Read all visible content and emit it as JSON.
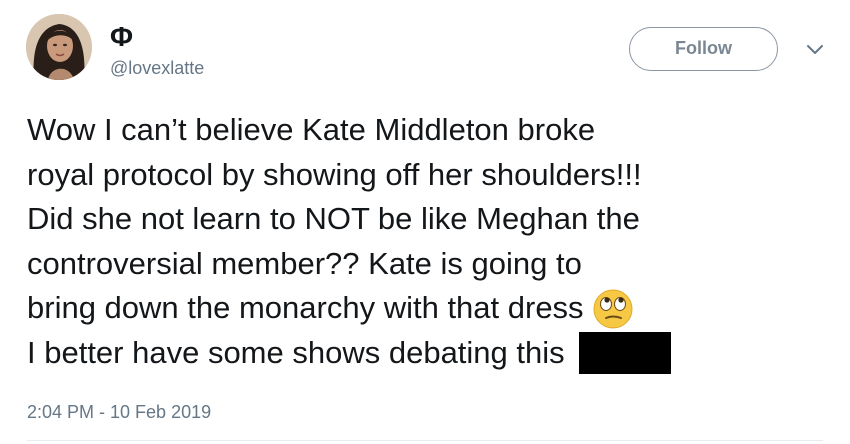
{
  "user": {
    "display_name": "Φ",
    "handle": "@lovexlatte",
    "avatar_icon": "profile-photo"
  },
  "actions": {
    "follow_label": "Follow",
    "menu_icon": "chevron-down-icon"
  },
  "tweet": {
    "lines": [
      "Wow I can’t believe Kate Middleton broke",
      "royal protocol by showing off her shoulders!!!",
      "Did she not learn to NOT be like Meghan the",
      "controversial member?? Kate is going to",
      "bring down the monarchy with that dress",
      "I better have some shows debating this"
    ],
    "emoji_icon": "face-with-rolling-eyes-emoji",
    "redaction": "black-redaction-box"
  },
  "meta": {
    "timestamp": "2:04 PM - 10 Feb 2019"
  },
  "colors": {
    "text": "#14171a",
    "secondary": "#657786",
    "button_border": "#8a96a3",
    "emoji_face": "#f7c843"
  }
}
